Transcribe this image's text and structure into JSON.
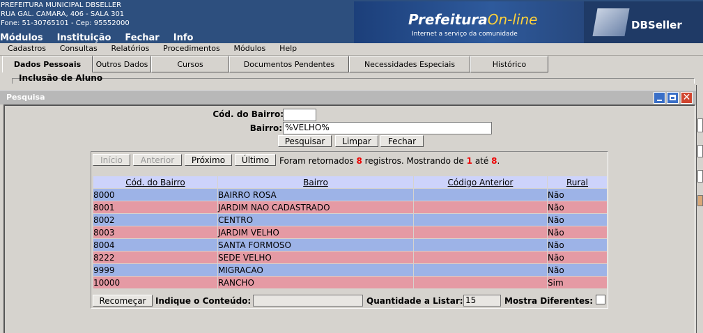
{
  "header": {
    "org_name": "PREFEITURA MUNICIPAL DBSELLER",
    "address": "RUA GAL. CAMARA, 406 - SALA 301",
    "contact": "Fone: 51-30765101  -  Cep: 95552000",
    "top_menu": [
      "Módulos",
      "Instituição",
      "Fechar",
      "Info"
    ],
    "banner_brand": "Prefeitura",
    "banner_brand_accent": "On-line",
    "banner_tagline": "Internet a serviço da comunidade",
    "vendor_logo": "DBSeller"
  },
  "menubar": [
    "Cadastros",
    "Consultas",
    "Relatórios",
    "Procedimentos",
    "Módulos",
    "Help"
  ],
  "tabs": [
    "Dados Pessoais",
    "Outros Dados",
    "Cursos",
    "Documentos Pendentes",
    "Necessidades Especiais",
    "Histórico"
  ],
  "fieldset_legend": "Inclusão de Aluno",
  "window": {
    "title": "Pesquisa",
    "close_glyph": "✕"
  },
  "form": {
    "cod_bairro_label": "Cód. do Bairro:",
    "cod_bairro_value": "",
    "bairro_label": "Bairro:",
    "bairro_value": "%VELHO%",
    "btn_pesquisar": "Pesquisar",
    "btn_limpar": "Limpar",
    "btn_fechar": "Fechar"
  },
  "nav": {
    "inicio": "Início",
    "anterior": "Anterior",
    "proximo": "Próximo",
    "ultimo": "Último",
    "text_1": "Foram retornados",
    "total": "8",
    "text_2": "registros. Mostrando de",
    "from": "1",
    "text_3": "até",
    "to": "8",
    "text_4": "."
  },
  "table": {
    "columns": [
      "Cód. do Bairro",
      "Bairro",
      "Código Anterior",
      "Rural"
    ],
    "rows": [
      [
        "8000",
        "BAIRRO ROSA",
        "",
        "Não"
      ],
      [
        "8001",
        "JARDIM NAO CADASTRADO",
        "",
        "Não"
      ],
      [
        "8002",
        "CENTRO",
        "",
        "Não"
      ],
      [
        "8003",
        "JARDIM VELHO",
        "",
        "Não"
      ],
      [
        "8004",
        "SANTA FORMOSO",
        "",
        "Não"
      ],
      [
        "8222",
        "SEDE VELHO",
        "",
        "Não"
      ],
      [
        "9999",
        "MIGRACAO",
        "",
        "Não"
      ],
      [
        "10000",
        "RANCHO",
        "",
        "Sim"
      ]
    ],
    "row_colors": [
      "#9db3e7",
      "#e59aa4"
    ]
  },
  "footer": {
    "btn_recomecar": "Recomeçar",
    "indique_label": "Indique o Conteúdo:",
    "indique_value": "",
    "quantidade_label": "Quantidade a Listar:",
    "quantidade_value": "15",
    "mostra_label": "Mostra Diferentes:"
  }
}
